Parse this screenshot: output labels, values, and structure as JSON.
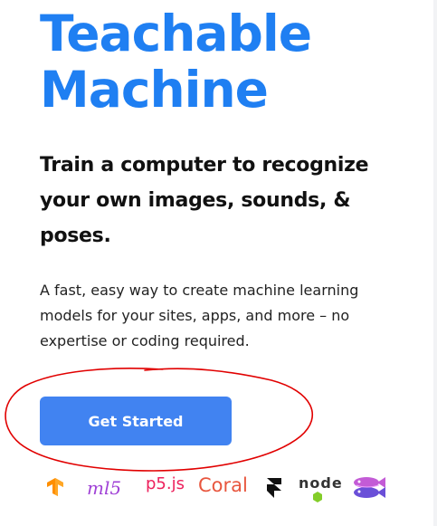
{
  "hero": {
    "title_line1": "Teachable",
    "title_line2": "Machine"
  },
  "subtitle": {
    "line1": "Train a computer to recognize",
    "line2": "your own images, sounds, &",
    "line3": "poses."
  },
  "description": {
    "line1": "A fast, easy way to create machine learning",
    "line2": "models for your sites, apps, and more – no",
    "line3": "expertise or coding required."
  },
  "cta": {
    "label": "Get Started"
  },
  "logos": {
    "ml5": "ml5",
    "p5": "p5.js",
    "coral": "Coral",
    "node": "node",
    "items": [
      {
        "name": "tensorflow",
        "icon": "tensorflow-logo-icon"
      },
      {
        "name": "ml5",
        "icon": "ml5-logo"
      },
      {
        "name": "p5.js",
        "icon": "p5js-logo"
      },
      {
        "name": "Coral",
        "icon": "coral-logo"
      },
      {
        "name": "framer",
        "icon": "framer-logo-icon"
      },
      {
        "name": "node",
        "icon": "nodejs-logo"
      },
      {
        "name": "fish",
        "icon": "fish-logo-icon"
      }
    ]
  },
  "colors": {
    "accent": "#1f7ff2",
    "button": "#4183f1",
    "annotation": "#e10000"
  }
}
